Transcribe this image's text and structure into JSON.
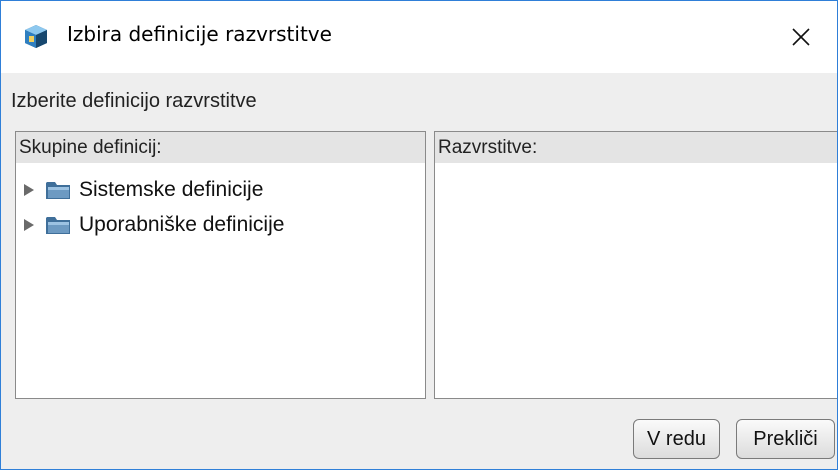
{
  "window": {
    "title": "Izbira definicije razvrstitve",
    "icon": "app-cube-icon",
    "close_icon": "close-icon"
  },
  "instruction": "Izberite definicijo razvrstitve",
  "left_panel": {
    "header": "Skupine definicij:",
    "items": [
      {
        "label": "Sistemske definicije",
        "expanded": false,
        "icon": "folder-icon"
      },
      {
        "label": "Uporabniške definicije",
        "expanded": false,
        "icon": "folder-icon"
      }
    ]
  },
  "right_panel": {
    "header": "Razvrstitve:",
    "items": []
  },
  "buttons": {
    "ok_label": "V redu",
    "cancel_label": "Prekliči"
  },
  "colors": {
    "window_border": "#2f7fd8",
    "dialog_background": "#eeeeee",
    "header_background": "#e4e4e4",
    "folder_blue": "#3f6f9a"
  }
}
